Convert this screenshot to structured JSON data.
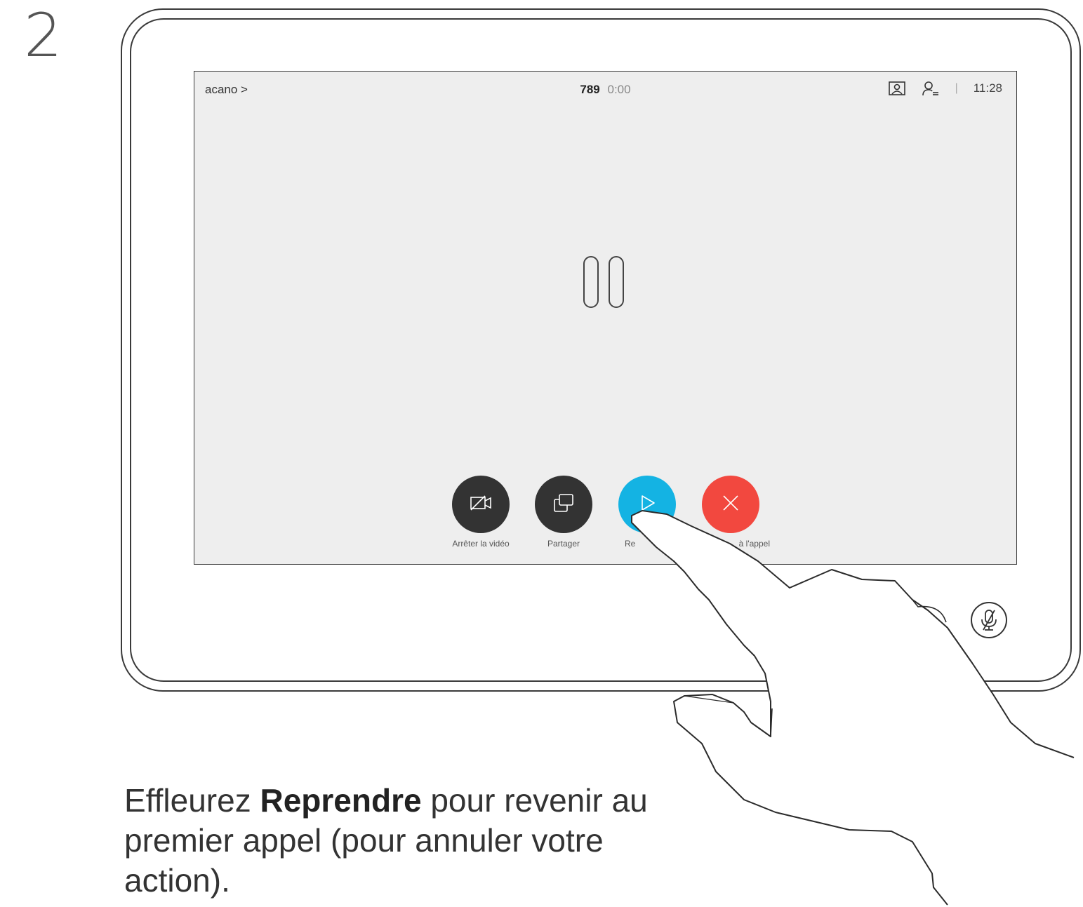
{
  "step": {
    "number": "2"
  },
  "topbar": {
    "breadcrumb": "acano >",
    "call_number": "789",
    "call_timer": "0:00",
    "clock": "11:28",
    "separator": "|",
    "icons": [
      "layout-icon",
      "participants-icon"
    ]
  },
  "screen": {
    "status_icon": "pause-icon"
  },
  "controls": [
    {
      "label": "Arrêter la vidéo",
      "icon": "video-off-icon",
      "color": "#333333"
    },
    {
      "label": "Partager",
      "icon": "share-icon",
      "color": "#333333"
    },
    {
      "label": "Re",
      "icon": "play-icon",
      "color": "#14b3e3"
    },
    {
      "label": "à l'appel",
      "icon": "close-icon",
      "color": "#f2483f"
    }
  ],
  "device": {
    "mic_icon": "mic-muted-icon"
  },
  "caption": {
    "part1": "Effleurez ",
    "bold": "Reprendre",
    "part2": " pour revenir au premier appel (pour annuler votre action)."
  }
}
